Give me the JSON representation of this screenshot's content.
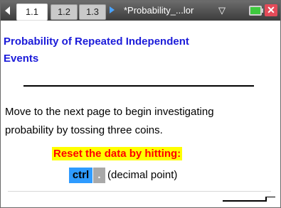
{
  "tabs": [
    {
      "label": "1.1",
      "active": true
    },
    {
      "label": "1.2",
      "active": false
    },
    {
      "label": "1.3",
      "active": false
    }
  ],
  "document_title": "*Probability_...lor",
  "dropdown_glyph": "▽",
  "close_glyph": "✕",
  "page": {
    "title_line1": "Probability of Repeated Independent",
    "title_line2": "Events",
    "body_line1": "Move to the next page to begin investigating",
    "body_line2": "probability by tossing three coins.",
    "reset_text": "Reset the data by hitting:",
    "ctrl_key": "ctrl",
    "dot_key": ".",
    "dot_note": "(decimal point)"
  },
  "colors": {
    "title": "#1b1bd9",
    "reset_text": "#ff0000",
    "reset_bg": "#ffff00",
    "ctrl_bg": "#2e9bff",
    "dot_bg": "#a9a9a9",
    "close": "#e44b59",
    "battery": "#3ec93e"
  },
  "icons": [
    "arrow-left-icon",
    "arrow-right-icon",
    "dropdown-chevron-icon",
    "battery-icon",
    "close-icon"
  ]
}
